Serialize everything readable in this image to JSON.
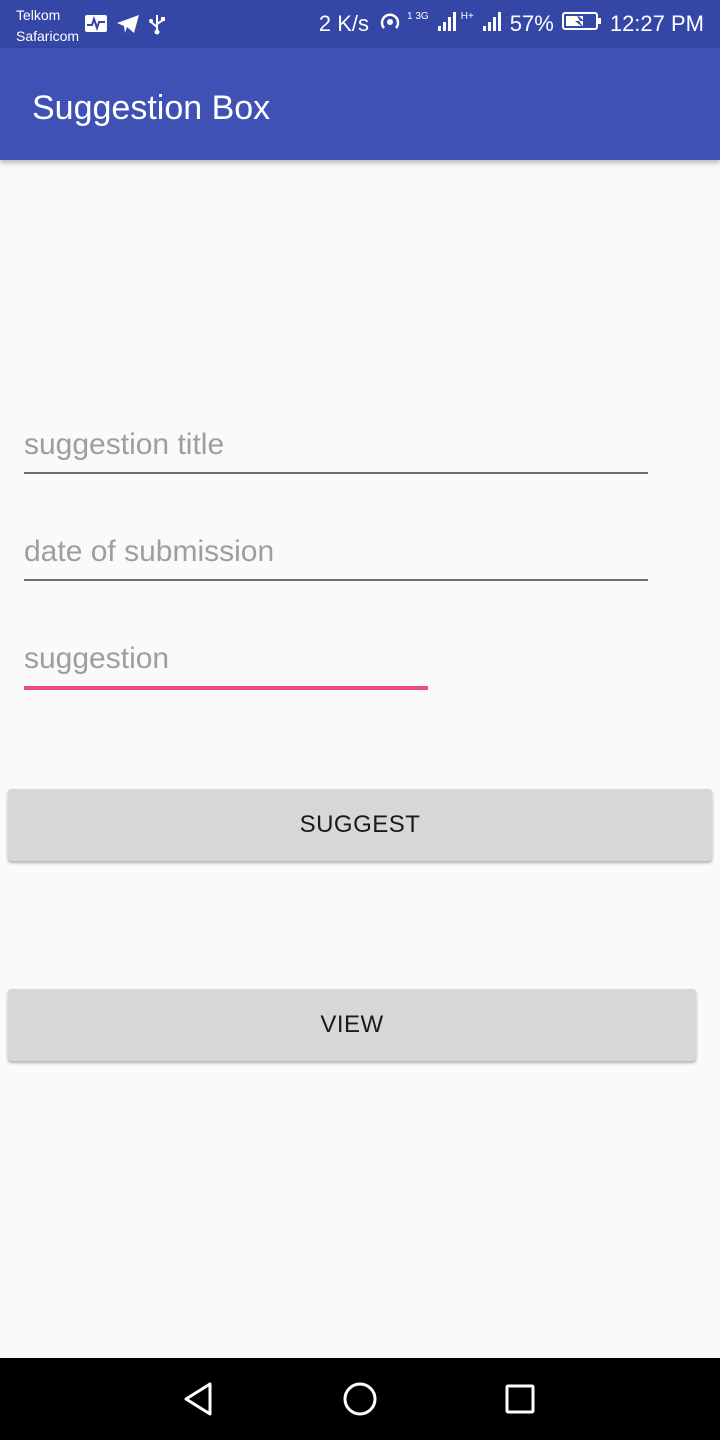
{
  "status_bar": {
    "carrier_1": "Telkom",
    "carrier_2": "Safaricom",
    "net_speed": "2 K/s",
    "sim1_network": "1 3G",
    "sim2_network": "H+",
    "battery": "57%",
    "time": "12:27 PM",
    "icons": [
      "activity-icon",
      "telegram-icon",
      "usb-icon",
      "hotspot-icon",
      "signal-icon",
      "battery-charging-icon"
    ]
  },
  "app_bar": {
    "title": "Suggestion Box"
  },
  "form": {
    "title_placeholder": "suggestion title",
    "date_placeholder": "date of submission",
    "suggestion_placeholder": "suggestion",
    "suggest_label": "SUGGEST",
    "view_label": "VIEW"
  },
  "nav_bar": {
    "icons": [
      "back-icon",
      "home-icon",
      "recents-icon"
    ]
  },
  "colors": {
    "status_bar": "#3446a6",
    "app_bar": "#3f51b5",
    "accent": "#e94d86",
    "button": "#d6d7d7",
    "background": "#fafafa"
  }
}
